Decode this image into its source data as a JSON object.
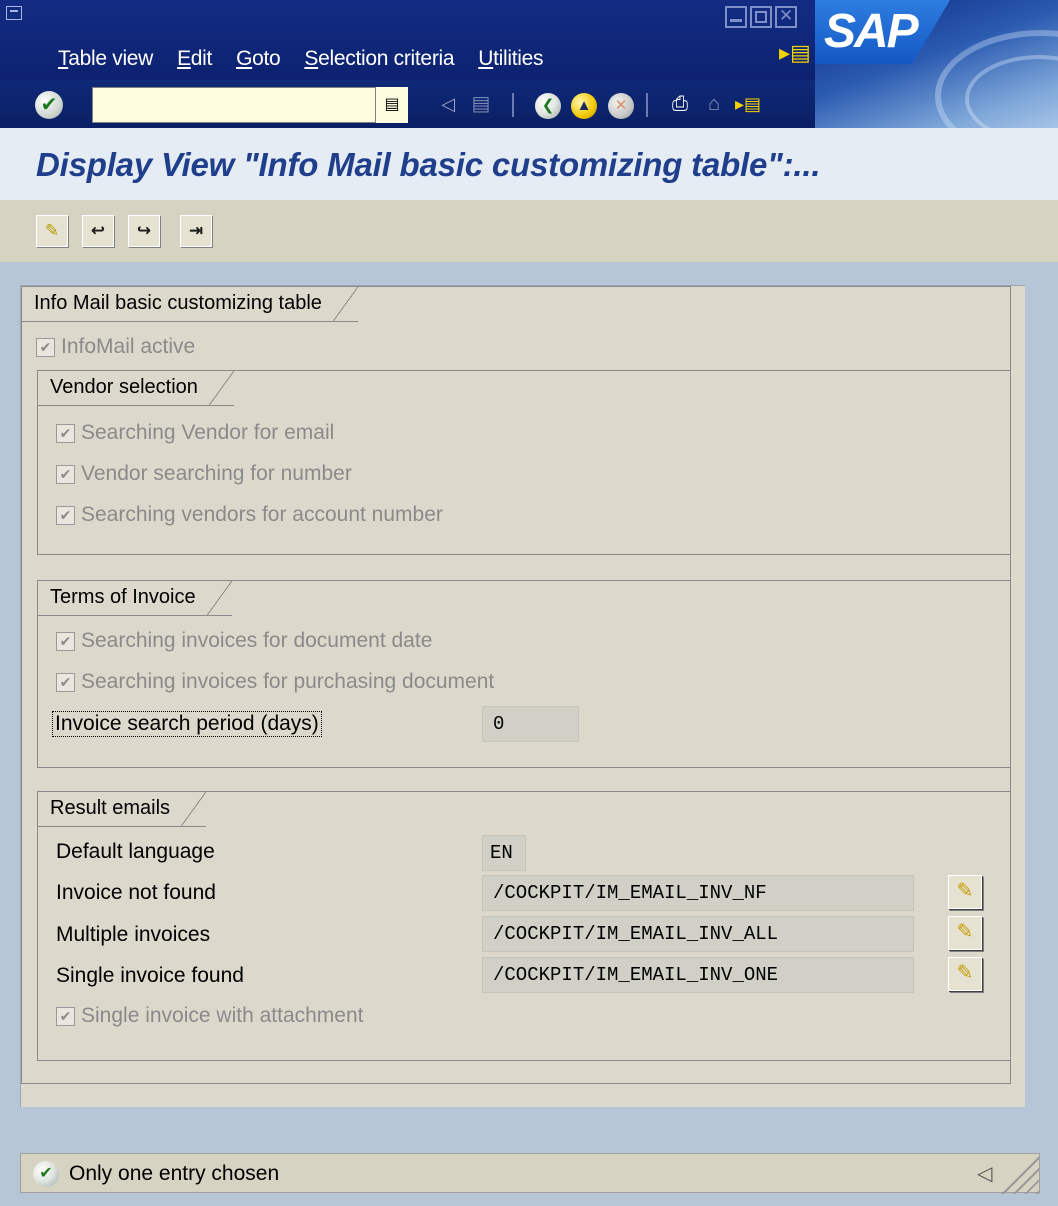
{
  "menu": {
    "items": [
      "Table view",
      "Edit",
      "Goto",
      "Selection criteria",
      "Utilities"
    ]
  },
  "brand": {
    "logo_text": "SAP",
    "accent": "#1458c4"
  },
  "toolbar": {
    "command_value": "",
    "command_history_icon": "history-icon",
    "icons": [
      "back-icon",
      "save-icon",
      "green-arrow-back-icon",
      "exit-icon",
      "cancel-icon",
      "print-icon",
      "find-icon",
      "find-next-icon"
    ]
  },
  "title": "Display View \"Info Mail basic customizing table\":...",
  "app_toolbar": {
    "icons": [
      "change-display-icon",
      "previous-entry-icon",
      "next-entry-icon",
      "last-entry-icon"
    ]
  },
  "main_frame": {
    "title": "Info Mail basic customizing table",
    "infomail_active": {
      "label": "InfoMail active",
      "checked": true
    }
  },
  "vendor_selection": {
    "title": "Vendor selection",
    "options": [
      {
        "label": "Searching  Vendor for email",
        "checked": true
      },
      {
        "label": "Vendor searching for number",
        "checked": true
      },
      {
        "label": "Searching vendors for account number",
        "checked": true
      }
    ]
  },
  "terms_of_invoice": {
    "title": "Terms of Invoice",
    "options": [
      {
        "label": "Searching invoices for document date",
        "checked": true
      },
      {
        "label": "Searching invoices for purchasing document",
        "checked": true
      }
    ],
    "period_label": "Invoice search period (days)",
    "period_value": "0"
  },
  "result_emails": {
    "title": "Result emails",
    "default_language_label": "Default language",
    "default_language_value": "EN",
    "rows": [
      {
        "label": "Invoice not found",
        "value": "/COCKPIT/IM_EMAIL_INV_NF"
      },
      {
        "label": "Multiple invoices",
        "value": "/COCKPIT/IM_EMAIL_INV_ALL"
      },
      {
        "label": "Single invoice found",
        "value": "/COCKPIT/IM_EMAIL_INV_ONE"
      }
    ],
    "attachment_option": {
      "label": "Single invoice with attachment",
      "checked": true
    }
  },
  "status": {
    "text": "Only one entry chosen",
    "type": "success"
  }
}
